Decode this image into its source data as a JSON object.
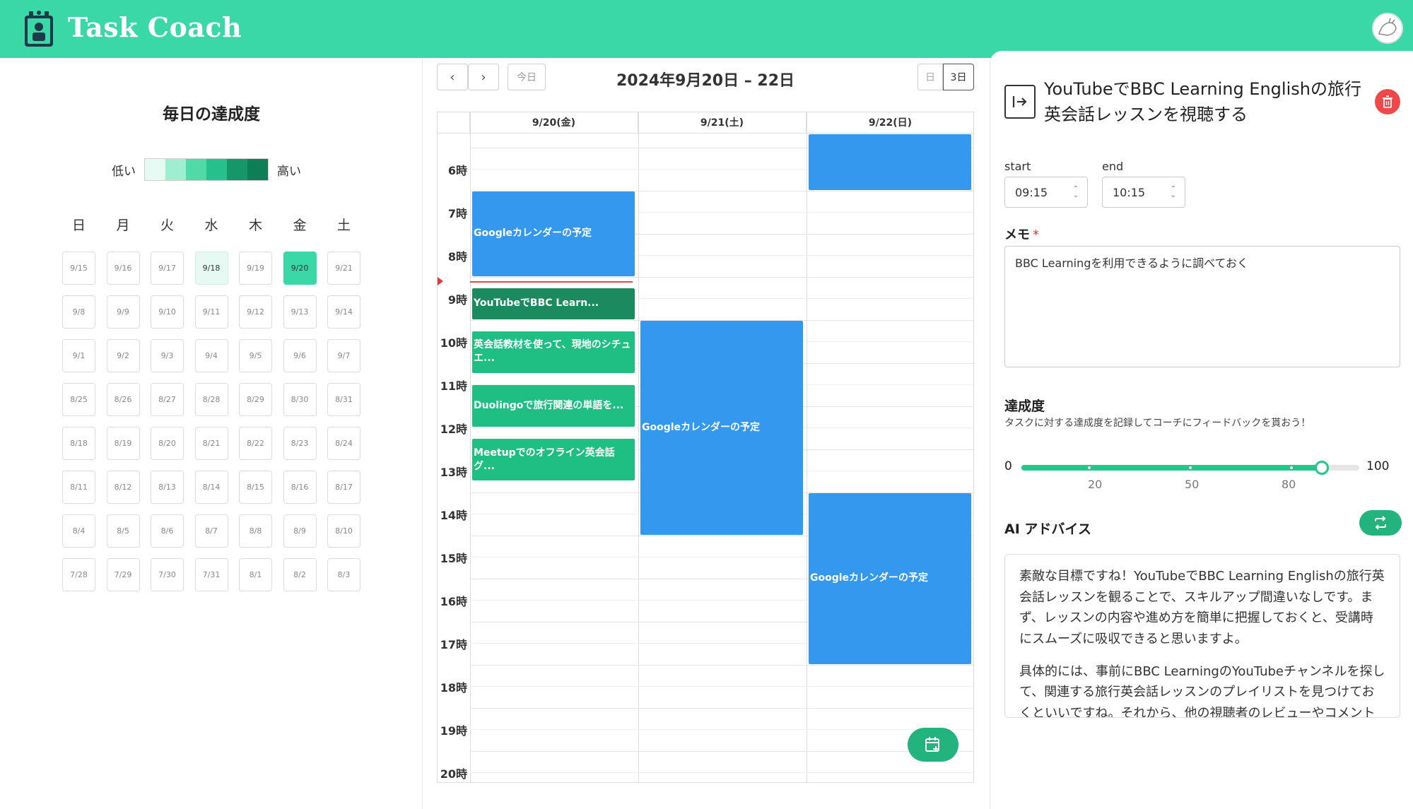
{
  "app": {
    "title": "Task Coach"
  },
  "left": {
    "title": "毎日の達成度",
    "legend": {
      "low": "低い",
      "high": "高い",
      "colors": [
        "#e6faf3",
        "#9eeed1",
        "#52d9a8",
        "#25c08c",
        "#17966a",
        "#0e7e56"
      ]
    },
    "weekdays": [
      "日",
      "月",
      "火",
      "水",
      "木",
      "金",
      "土"
    ],
    "calendar_rows": [
      [
        "9/15",
        "9/16",
        "9/17",
        "9/18",
        "9/19",
        "9/20",
        "9/21"
      ],
      [
        "9/8",
        "9/9",
        "9/10",
        "9/11",
        "9/12",
        "9/13",
        "9/14"
      ],
      [
        "9/1",
        "9/2",
        "9/3",
        "9/4",
        "9/5",
        "9/6",
        "9/7"
      ],
      [
        "8/25",
        "8/26",
        "8/27",
        "8/28",
        "8/29",
        "8/30",
        "8/31"
      ],
      [
        "8/18",
        "8/19",
        "8/20",
        "8/21",
        "8/22",
        "8/23",
        "8/24"
      ],
      [
        "8/11",
        "8/12",
        "8/13",
        "8/14",
        "8/15",
        "8/16",
        "8/17"
      ],
      [
        "8/4",
        "8/5",
        "8/6",
        "8/7",
        "8/8",
        "8/9",
        "8/10"
      ],
      [
        "7/28",
        "7/29",
        "7/30",
        "7/31",
        "8/1",
        "8/2",
        "8/3"
      ]
    ],
    "highlighted": {
      "9/18": "#e6faf3",
      "9/20": "#3ad8a6"
    }
  },
  "calendar": {
    "today_label": "今日",
    "prev_icon": "‹",
    "next_icon": "›",
    "range_title": "2024年9月20日 – 22日",
    "view_day": "日",
    "view_3day": "3日",
    "days": [
      "9/20(金)",
      "9/21(土)",
      "9/22(日)"
    ],
    "hours": [
      "6時",
      "7時",
      "8時",
      "9時",
      "10時",
      "11時",
      "12時",
      "13時",
      "14時",
      "15時",
      "16時",
      "17時",
      "18時",
      "19時",
      "20時"
    ],
    "events": [
      {
        "day": 2,
        "start": 5.4,
        "end": 7.0,
        "title": "",
        "color": "#3499ee"
      },
      {
        "day": 0,
        "start": 7.0,
        "end": 9.0,
        "title": "Googleカレンダーの予定",
        "color": "#3499ee"
      },
      {
        "day": 0,
        "start": 9.25,
        "end": 10.0,
        "title": "YouTubeでBBC Learn...",
        "color": "#1b8a5f"
      },
      {
        "day": 0,
        "start": 10.25,
        "end": 11.25,
        "title": "英会話教材を使って、現地のシチュエ...",
        "color": "#1fbf83"
      },
      {
        "day": 0,
        "start": 11.5,
        "end": 12.5,
        "title": "Duolingoで旅行関連の単語を...",
        "color": "#1fbf83"
      },
      {
        "day": 0,
        "start": 12.75,
        "end": 13.75,
        "title": "Meetupでのオフライン英会話グ...",
        "color": "#1fbf83"
      },
      {
        "day": 1,
        "start": 10.0,
        "end": 15.0,
        "title": "Googleカレンダーの予定",
        "color": "#3499ee"
      },
      {
        "day": 2,
        "start": 14.0,
        "end": 18.0,
        "title": "Googleカレンダーの予定",
        "color": "#3499ee"
      }
    ],
    "now": 9.3
  },
  "detail": {
    "task_title": "YouTubeでBBC Learning Englishの旅行英会話レッスンを視聴する",
    "start_label": "start",
    "end_label": "end",
    "start_value": "09:15",
    "end_value": "10:15",
    "memo_label": "メモ",
    "memo_required": "*",
    "memo_value": "BBC Learningを利用できるように調べておく",
    "achievement_title": "達成度",
    "achievement_sub": "タスクに対する達成度を記録してコーチにフィードバックを貰おう！",
    "slider": {
      "min": "0",
      "max": "100",
      "value": 89,
      "ticks": [
        "20",
        "50",
        "80"
      ]
    },
    "ai_title": "AI アドバイス",
    "advice": [
      "素敵な目標ですね！YouTubeでBBC Learning Englishの旅行英会話レッスンを観ることで、スキルアップ間違いなしです。まず、レッスンの内容や進め方を簡単に把握しておくと、受講時にスムーズに吸収できると思いますよ。",
      "具体的には、事前にBBC LearningのYouTubeチャンネルを探して、関連する旅行英会話レッスンのプレイリストを見つけておくといいですね。それから、他の視聴者のレビューやコメントを参考にするのもおすすめです。"
    ]
  }
}
